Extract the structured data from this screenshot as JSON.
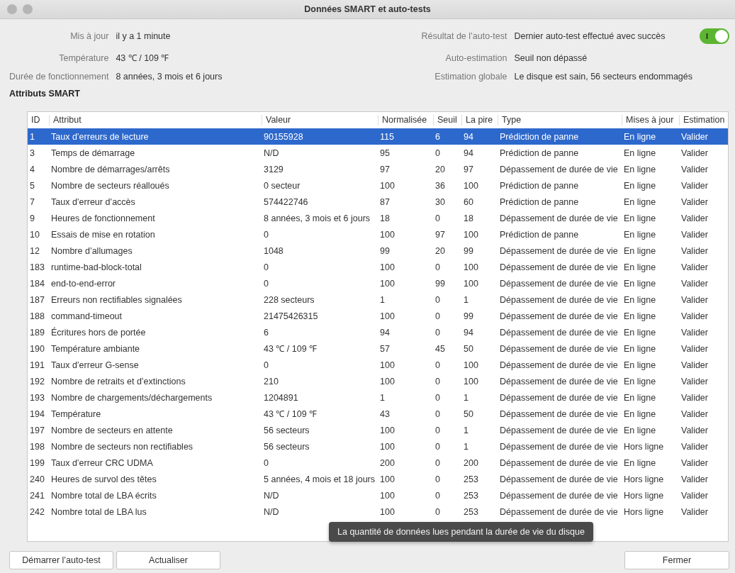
{
  "window": {
    "title": "Données SMART et auto-tests"
  },
  "info_left": [
    {
      "label": "Mis à jour",
      "value": "il y a 1 minute"
    },
    {
      "label": "Température",
      "value": "43 ℃ / 109 ℉"
    },
    {
      "label": "Durée de fonctionnement",
      "value": "8 années, 3 mois et 6 jours"
    }
  ],
  "info_right": [
    {
      "label": "Résultat de l’auto-test",
      "value": "Dernier auto-test effectué avec succès"
    },
    {
      "label": "Auto-estimation",
      "value": "Seuil non dépassé"
    },
    {
      "label": "Estimation globale",
      "value": "Le disque est sain, 56 secteurs endommagés"
    }
  ],
  "smart_switch": {
    "label": "I",
    "on": true
  },
  "section_title": "Attributs SMART",
  "table": {
    "columns": [
      "ID",
      "Attribut",
      "Valeur",
      "Normalisée",
      "Seuil",
      "La pire",
      "Type",
      "Mises à jour",
      "Estimation"
    ],
    "rows": [
      {
        "selected": true,
        "cells": [
          "1",
          "Taux d’erreurs de lecture",
          "90155928",
          "115",
          "6",
          "94",
          "Prédiction de panne",
          "En ligne",
          "Valider"
        ]
      },
      {
        "selected": false,
        "cells": [
          "3",
          "Temps de démarrage",
          "N/D",
          "95",
          "0",
          "94",
          "Prédiction de panne",
          "En ligne",
          "Valider"
        ]
      },
      {
        "selected": false,
        "cells": [
          "4",
          "Nombre de démarrages/arrêts",
          "3129",
          "97",
          "20",
          "97",
          "Dépassement de durée de vie",
          "En ligne",
          "Valider"
        ]
      },
      {
        "selected": false,
        "cells": [
          "5",
          "Nombre de secteurs réalloués",
          "0 secteur",
          "100",
          "36",
          "100",
          "Prédiction de panne",
          "En ligne",
          "Valider"
        ]
      },
      {
        "selected": false,
        "cells": [
          "7",
          "Taux d’erreur d’accès",
          "574422746",
          "87",
          "30",
          "60",
          "Prédiction de panne",
          "En ligne",
          "Valider"
        ]
      },
      {
        "selected": false,
        "cells": [
          "9",
          "Heures de fonctionnement",
          "8 années, 3 mois et 6 jours",
          "18",
          "0",
          "18",
          "Dépassement de durée de vie",
          "En ligne",
          "Valider"
        ]
      },
      {
        "selected": false,
        "cells": [
          "10",
          "Essais de mise en rotation",
          "0",
          "100",
          "97",
          "100",
          "Prédiction de panne",
          "En ligne",
          "Valider"
        ]
      },
      {
        "selected": false,
        "cells": [
          "12",
          "Nombre d’allumages",
          "1048",
          "99",
          "20",
          "99",
          "Dépassement de durée de vie",
          "En ligne",
          "Valider"
        ]
      },
      {
        "selected": false,
        "cells": [
          "183",
          "runtime-bad-block-total",
          "0",
          "100",
          "0",
          "100",
          "Dépassement de durée de vie",
          "En ligne",
          "Valider"
        ]
      },
      {
        "selected": false,
        "cells": [
          "184",
          "end-to-end-error",
          "0",
          "100",
          "99",
          "100",
          "Dépassement de durée de vie",
          "En ligne",
          "Valider"
        ]
      },
      {
        "selected": false,
        "cells": [
          "187",
          "Erreurs non rectifiables signalées",
          "228 secteurs",
          "1",
          "0",
          "1",
          "Dépassement de durée de vie",
          "En ligne",
          "Valider"
        ]
      },
      {
        "selected": false,
        "cells": [
          "188",
          "command-timeout",
          "21475426315",
          "100",
          "0",
          "99",
          "Dépassement de durée de vie",
          "En ligne",
          "Valider"
        ]
      },
      {
        "selected": false,
        "cells": [
          "189",
          "Écritures hors de portée",
          "6",
          "94",
          "0",
          "94",
          "Dépassement de durée de vie",
          "En ligne",
          "Valider"
        ]
      },
      {
        "selected": false,
        "cells": [
          "190",
          "Température ambiante",
          "43 ℃ / 109 ℉",
          "57",
          "45",
          "50",
          "Dépassement de durée de vie",
          "En ligne",
          "Valider"
        ]
      },
      {
        "selected": false,
        "cells": [
          "191",
          "Taux d’erreur G-sense",
          "0",
          "100",
          "0",
          "100",
          "Dépassement de durée de vie",
          "En ligne",
          "Valider"
        ]
      },
      {
        "selected": false,
        "cells": [
          "192",
          "Nombre de retraits et d’extinctions",
          "210",
          "100",
          "0",
          "100",
          "Dépassement de durée de vie",
          "En ligne",
          "Valider"
        ]
      },
      {
        "selected": false,
        "cells": [
          "193",
          "Nombre de chargements/déchargements",
          "1204891",
          "1",
          "0",
          "1",
          "Dépassement de durée de vie",
          "En ligne",
          "Valider"
        ]
      },
      {
        "selected": false,
        "cells": [
          "194",
          "Température",
          "43 ℃ / 109 ℉",
          "43",
          "0",
          "50",
          "Dépassement de durée de vie",
          "En ligne",
          "Valider"
        ]
      },
      {
        "selected": false,
        "cells": [
          "197",
          "Nombre de secteurs en attente",
          "56 secteurs",
          "100",
          "0",
          "1",
          "Dépassement de durée de vie",
          "En ligne",
          "Valider"
        ]
      },
      {
        "selected": false,
        "cells": [
          "198",
          "Nombre de secteurs non rectifiables",
          "56 secteurs",
          "100",
          "0",
          "1",
          "Dépassement de durée de vie",
          "Hors ligne",
          "Valider"
        ]
      },
      {
        "selected": false,
        "cells": [
          "199",
          "Taux d’erreur CRC UDMA",
          "0",
          "200",
          "0",
          "200",
          "Dépassement de durée de vie",
          "En ligne",
          "Valider"
        ]
      },
      {
        "selected": false,
        "cells": [
          "240",
          "Heures de survol des têtes",
          "5 années, 4 mois et 18 jours",
          "100",
          "0",
          "253",
          "Dépassement de durée de vie",
          "Hors ligne",
          "Valider"
        ]
      },
      {
        "selected": false,
        "cells": [
          "241",
          "Nombre total de LBA écrits",
          "N/D",
          "100",
          "0",
          "253",
          "Dépassement de durée de vie",
          "Hors ligne",
          "Valider"
        ]
      },
      {
        "selected": false,
        "cells": [
          "242",
          "Nombre total de LBA lus",
          "N/D",
          "100",
          "0",
          "253",
          "Dépassement de durée de vie",
          "Hors ligne",
          "Valider"
        ]
      }
    ]
  },
  "tooltip": "La quantité de données lues pendant la durée de vie du disque",
  "buttons_left": [
    "Démarrer l’auto-test",
    "Actualiser"
  ],
  "buttons_right": [
    "Fermer"
  ]
}
